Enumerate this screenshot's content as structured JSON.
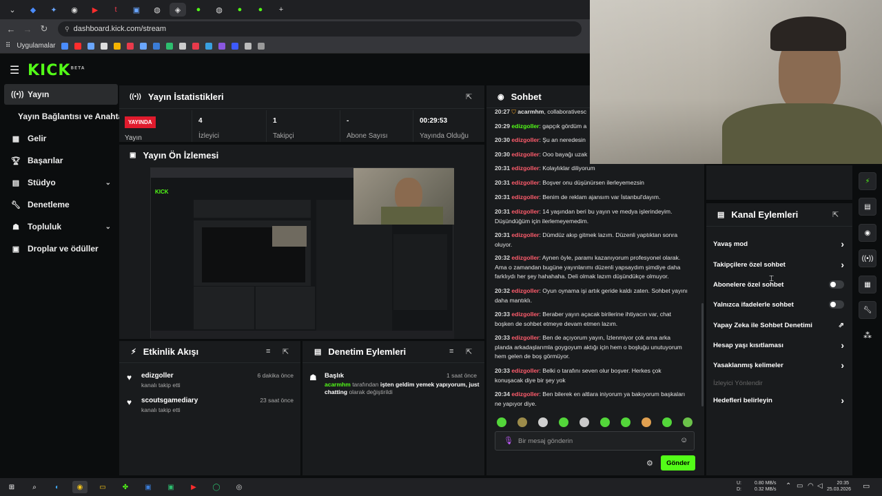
{
  "browser": {
    "url": "dashboard.kick.com/stream",
    "bookmark_label": "Uygulamalar"
  },
  "brand": {
    "logo": "KICK",
    "beta": "BETA"
  },
  "sidebar": {
    "items": [
      {
        "label": "Yayın",
        "icon": "broadcast-icon"
      },
      {
        "label": "Yayın Bağlantısı ve Anahtarı"
      },
      {
        "label": "Gelir",
        "icon": "chart-icon"
      },
      {
        "label": "Başarılar",
        "icon": "trophy-icon"
      },
      {
        "label": "Stüdyo",
        "icon": "studio-icon"
      },
      {
        "label": "Denetleme",
        "icon": "wrench-icon"
      },
      {
        "label": "Topluluk",
        "icon": "community-icon"
      },
      {
        "label": "Droplar ve ödüller",
        "icon": "drop-icon"
      }
    ]
  },
  "stats": {
    "title": "Yayın İstatistikleri",
    "live_badge": "YAYINDA",
    "status_label": "Yayın",
    "viewers_value": "4",
    "viewers_label": "İzleyici",
    "followers_value": "1",
    "followers_label": "Takipçi",
    "subs_value": "-",
    "subs_label": "Abone Sayısı",
    "uptime_value": "00:29:53",
    "uptime_label": "Yayında Olduğu"
  },
  "preview": {
    "title": "Yayın Ön İzlemesi"
  },
  "activity": {
    "title": "Etkinlik Akışı",
    "items": [
      {
        "user": "edizgoller",
        "action": "kanalı takip etti",
        "time": "6 dakika önce"
      },
      {
        "user": "scoutsgamediary",
        "action": "kanalı takip etti",
        "time": "23 saat önce"
      }
    ]
  },
  "moderation": {
    "title": "Denetim Eylemleri",
    "item_title": "Başlık",
    "item_time": "1 saat önce",
    "item_user": "acarmhm",
    "item_by": "tarafından",
    "item_value": "işten geldim yemek yapıyorum, just chatting",
    "item_suffix": "olarak değiştirildi"
  },
  "chat": {
    "title": "Sohbet",
    "messages": [
      {
        "time": "20:27",
        "user": "acarmhm",
        "text": ", collaborativesc"
      },
      {
        "time": "20:29",
        "user": "edizgoller",
        "text": ": gapçık gördüm a"
      },
      {
        "time": "20:30",
        "user": "edizgoller",
        "text": ": Şu an neredesin"
      },
      {
        "time": "20:30",
        "user": "edizgoller",
        "text": ": Ooo bayağı uzak"
      },
      {
        "time": "20:31",
        "user": "edizgoller",
        "text": ": Kolaylıklar diliyorum"
      },
      {
        "time": "20:31",
        "user": "edizgoller",
        "text": ": Boşver onu düşünürsen ilerleyemezsin"
      },
      {
        "time": "20:31",
        "user": "edizgoller",
        "text": ": Benim de reklam ajansım var İstanbul'dayım."
      },
      {
        "time": "20:31",
        "user": "edizgoller",
        "text": ": 14 yaşından beri bu yayın ve medya işlerindeyim. Düşündüğüm için ilerlemeyemedim."
      },
      {
        "time": "20:31",
        "user": "edizgoller",
        "text": ": Dümdüz akıp gitmek lazım. Düzenli yaptıktan sonra oluyor."
      },
      {
        "time": "20:32",
        "user": "edizgoller",
        "text": ": Aynen öyle, paramı kazanıyorum profesyonel olarak. Ama o zamandan bugüne yayınlarımı düzenli yapsaydım şimdiye daha farklıydı her şey hahahaha. Deli olmak lazım düşündükçe olmuyor."
      },
      {
        "time": "20:32",
        "user": "edizgoller",
        "text": ": Oyun oynama işi artık geride kaldı zaten. Sohbet yayını daha mantıklı."
      },
      {
        "time": "20:33",
        "user": "edizgoller",
        "text": ": Beraber yayın açacak birilerine ihtiyacın var, chat boşken de sohbet etmeye devam etmen lazım."
      },
      {
        "time": "20:33",
        "user": "edizgoller",
        "text": ": Ben de açıyorum yayın, İzlenmiyor çok ama arka planda arkadaşlarımla goygoyum aktığı için hem o boşluğu unutuyorum hem gelen de boş görmüyor."
      },
      {
        "time": "20:33",
        "user": "edizgoller",
        "text": ": Belki o tarafını seven olur boşver. Herkes çok konuşacak diye bir şey yok"
      },
      {
        "time": "20:34",
        "user": "edizgoller",
        "text": ": Ben bilerek en altlara iniyorum ya bakıyorum başkaları ne yapıyor diye."
      }
    ],
    "placeholder": "Bir mesaj gönderin",
    "send_label": "Gönder"
  },
  "channel_actions": {
    "title": "Kanal Eylemleri",
    "items": [
      {
        "label": "Yavaş mod",
        "control": "chevron"
      },
      {
        "label": "Takipçilere özel sohbet",
        "control": "chevron"
      },
      {
        "label": "Abonelere özel sohbet",
        "control": "toggle",
        "value": "off"
      },
      {
        "label": "Yalnızca ifadelerle sohbet",
        "control": "toggle",
        "value": "off"
      },
      {
        "label": "Yapay Zeka ile Sohbet Denetimi",
        "control": "external"
      },
      {
        "label": "Hesap yaşı kısıtlaması",
        "control": "chevron"
      },
      {
        "label": "Yasaklanmış kelimeler",
        "control": "chevron"
      },
      {
        "label": "İzleyici Yönlendir",
        "control": "disabled"
      },
      {
        "label": "Hedefleri belirleyin",
        "control": "chevron"
      }
    ]
  },
  "taskbar": {
    "net_up": "0.80 MB/s",
    "net_down": "0.32 MB/s",
    "net_up_label": "U:",
    "net_down_label": "D:",
    "time": "20:35",
    "date": "25.03.2026"
  },
  "colors": {
    "accent": "#53fc18",
    "live": "#e01b2d",
    "username": "#ff5c6c",
    "panel": "#191b1d"
  }
}
